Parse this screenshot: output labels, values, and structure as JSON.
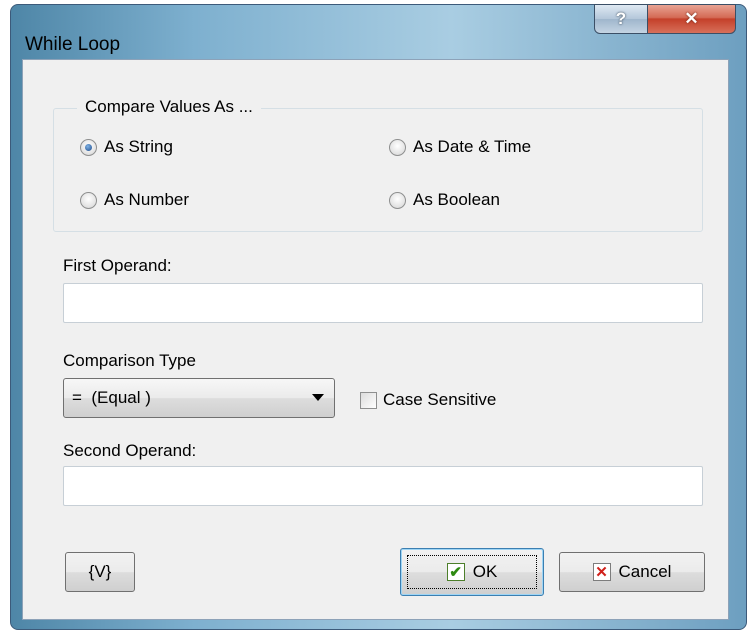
{
  "window": {
    "title": "While Loop"
  },
  "titlebar": {
    "help_label": "?",
    "close_label": "✕"
  },
  "compare_group": {
    "title": "Compare Values  As ...",
    "options": [
      {
        "label": "As String",
        "selected": true
      },
      {
        "label": "As Date & Time",
        "selected": false
      },
      {
        "label": "As Number",
        "selected": false
      },
      {
        "label": "As Boolean",
        "selected": false
      }
    ]
  },
  "first_operand": {
    "label": "First Operand:",
    "value": ""
  },
  "comparison": {
    "label": "Comparison Type",
    "selected": "=  (Equal )"
  },
  "case_sensitive": {
    "label": "Case Sensitive",
    "checked": false
  },
  "second_operand": {
    "label": "Second Operand:",
    "value": ""
  },
  "buttons": {
    "variables": "{V}",
    "ok": "OK",
    "cancel": "Cancel"
  }
}
